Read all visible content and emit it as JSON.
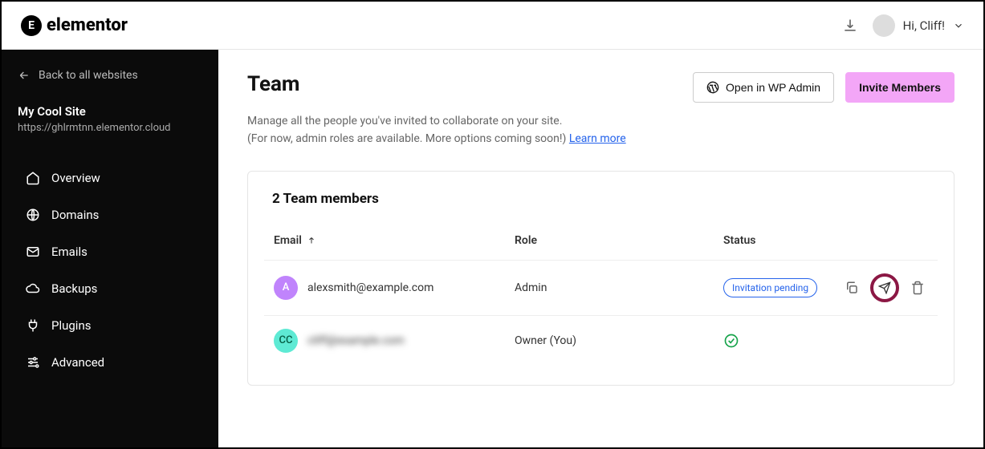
{
  "header": {
    "brand": "elementor",
    "greeting": "Hi, Cliff!"
  },
  "sidebar": {
    "back_label": "Back to all websites",
    "site_name": "My Cool Site",
    "site_url": "https://ghlrmtnn.elementor.cloud",
    "nav": {
      "overview": "Overview",
      "domains": "Domains",
      "emails": "Emails",
      "backups": "Backups",
      "plugins": "Plugins",
      "advanced": "Advanced"
    }
  },
  "main": {
    "title": "Team",
    "wp_admin_label": "Open in WP Admin",
    "invite_label": "Invite Members",
    "subtitle_line1": "Manage all the people you've invited to collaborate on your site.",
    "subtitle_line2_prefix": "(For now, admin roles are available. More options coming soon!) ",
    "learn_more": "Learn more",
    "card_title": "2 Team members",
    "columns": {
      "email": "Email",
      "role": "Role",
      "status": "Status"
    },
    "members": [
      {
        "avatar_text": "A",
        "email": "alexsmith@example.com",
        "role": "Admin",
        "status_label": "Invitation pending"
      },
      {
        "avatar_text": "CC",
        "email": "cliff@example.com",
        "role": "Owner (You)"
      }
    ]
  }
}
